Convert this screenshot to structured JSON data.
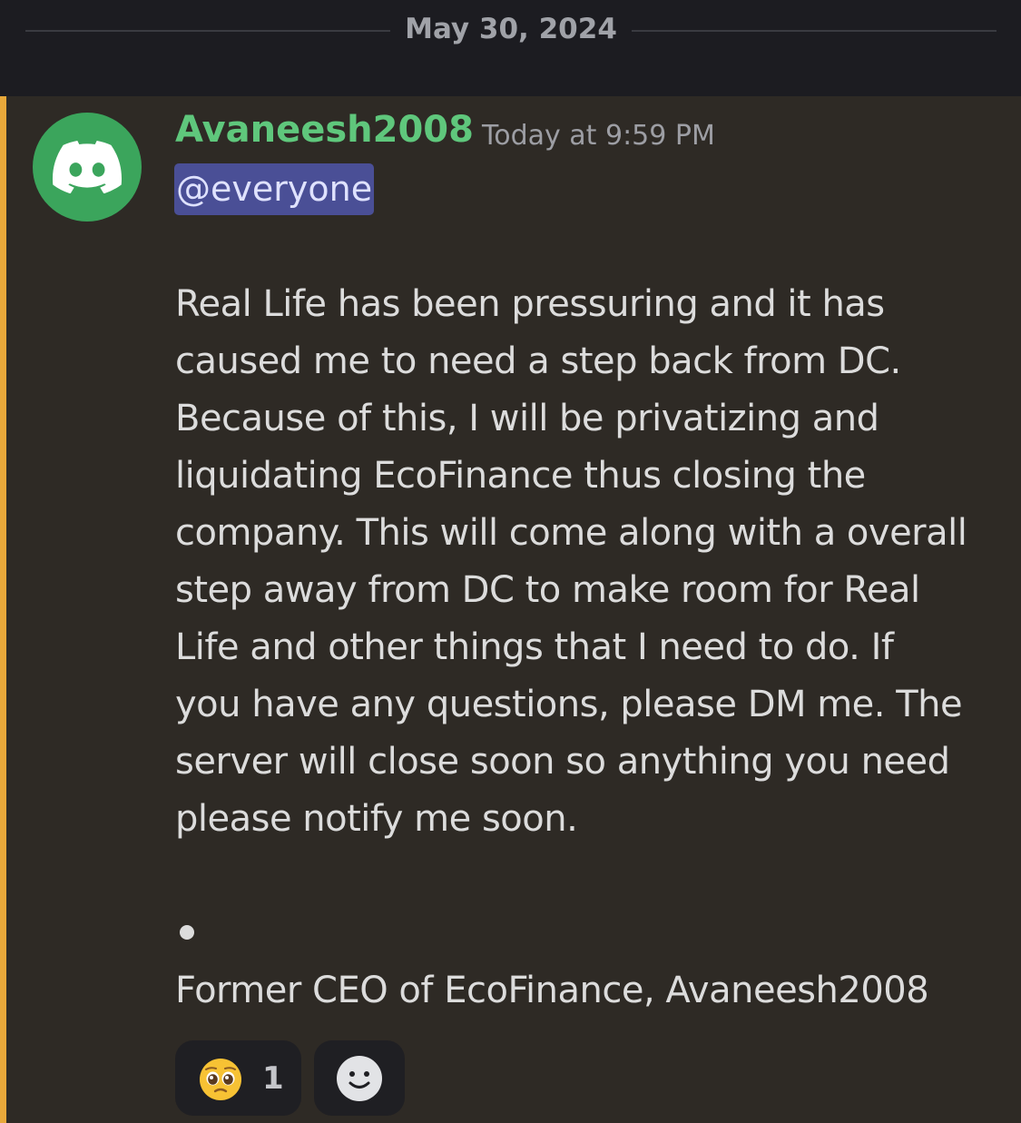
{
  "date_divider": {
    "label": "May 30, 2024"
  },
  "message": {
    "author": "Avaneesh2008",
    "timestamp": "Today at 9:59 PM",
    "mention": "@everyone",
    "body_lines": [
      "Real Life has been pressuring and it has",
      "caused me to need a step back from DC.",
      "Because of this, I will be privatizing and",
      "liquidating EcoFinance thus closing the",
      "company. This will come along with a overall",
      "step away from DC to make room for Real",
      "Life and other things that I need to do. If",
      "you have any questions, please DM me. The",
      "server will close soon so anything you need",
      "please notify me soon."
    ],
    "signature": "Former CEO of EcoFinance, Avaneesh2008",
    "avatar_icon": "discord-logo-icon"
  },
  "reactions": [
    {
      "emoji": "pleading-face-icon",
      "count": "1"
    },
    {
      "emoji": "add-reaction-smiley-icon"
    }
  ],
  "colors": {
    "background": "#1c1c21",
    "message_highlight": "#2e2a25",
    "mention_bar": "#e8a83a",
    "username": "#5fc77c",
    "avatar": "#3ba55c",
    "mention_bg": "#4a4f96"
  }
}
